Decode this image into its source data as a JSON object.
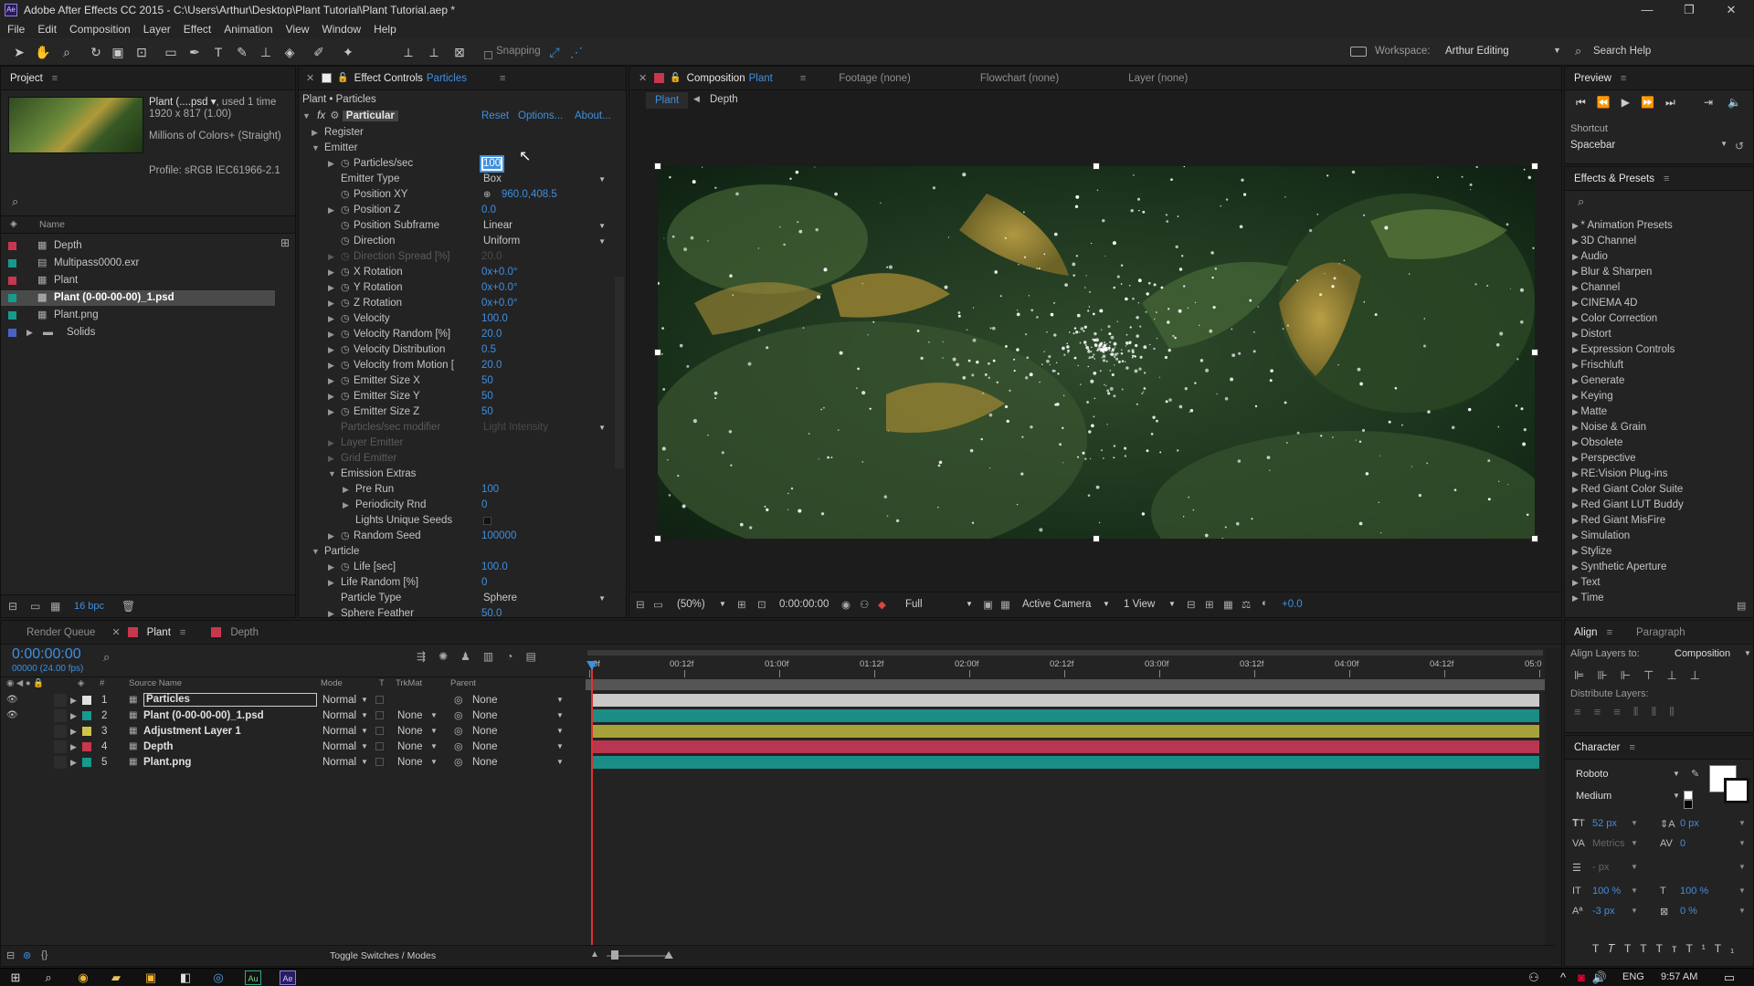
{
  "window": {
    "title": "Adobe After Effects CC 2015 - C:\\Users\\Arthur\\Desktop\\Plant Tutorial\\Plant Tutorial.aep *"
  },
  "menu": [
    "File",
    "Edit",
    "Composition",
    "Layer",
    "Effect",
    "Animation",
    "View",
    "Window",
    "Help"
  ],
  "toolbar": {
    "snapping": "Snapping",
    "workspace_label": "Workspace:",
    "workspace_value": "Arthur Editing",
    "search_help": "Search Help"
  },
  "project": {
    "tab": "Project",
    "asset_name": "Plant (....psd ▾",
    "used": ", used 1 time",
    "dimensions": "1920 x 817 (1.00)",
    "colors": "Millions of Colors+ (Straight)",
    "profile": "Profile: sRGB IEC61966-2.1",
    "col_name": "Name",
    "items": [
      {
        "label": "Depth",
        "color": "#c8374d"
      },
      {
        "label": "Multipass0000.exr",
        "color": "#169a8e"
      },
      {
        "label": "Plant",
        "color": "#c8374d"
      },
      {
        "label": "Plant (0-00-00-00)_1.psd",
        "color": "#169a8e"
      },
      {
        "label": "Plant.png",
        "color": "#169a8e"
      },
      {
        "label": "Solids",
        "color": "#4a62c8"
      }
    ],
    "bpc": "16 bpc"
  },
  "effect_controls": {
    "tab_label": "Effect Controls",
    "tab_layer": "Particles",
    "breadcrumb": "Plant • Particles",
    "effect_name": "Particular",
    "reset": "Reset",
    "options": "Options...",
    "about": "About...",
    "rows": [
      {
        "indent": 1,
        "label": "Register",
        "tri": "▶"
      },
      {
        "indent": 1,
        "label": "Emitter",
        "tri": "▼"
      },
      {
        "indent": 2,
        "label": "Particles/sec",
        "tri": "▶",
        "sw": true,
        "value": "100",
        "editing": true
      },
      {
        "indent": 2,
        "label": "Emitter Type",
        "dropdown": "Box"
      },
      {
        "indent": 2,
        "label": "Position XY",
        "sw": true,
        "value": "960.0,408.5",
        "target": true
      },
      {
        "indent": 2,
        "label": "Position Z",
        "tri": "▶",
        "sw": true,
        "value": "0.0"
      },
      {
        "indent": 2,
        "label": "Position Subframe",
        "sw": true,
        "dropdown": "Linear"
      },
      {
        "indent": 2,
        "label": "Direction",
        "sw": true,
        "dropdown": "Uniform"
      },
      {
        "indent": 2,
        "label": "Direction Spread [%]",
        "tri": "▶",
        "sw": true,
        "value": "20.0",
        "dim": true
      },
      {
        "indent": 2,
        "label": "X Rotation",
        "tri": "▶",
        "sw": true,
        "value": "0x+0.0°"
      },
      {
        "indent": 2,
        "label": "Y Rotation",
        "tri": "▶",
        "sw": true,
        "value": "0x+0.0°"
      },
      {
        "indent": 2,
        "label": "Z Rotation",
        "tri": "▶",
        "sw": true,
        "value": "0x+0.0°"
      },
      {
        "indent": 2,
        "label": "Velocity",
        "tri": "▶",
        "sw": true,
        "value": "100.0"
      },
      {
        "indent": 2,
        "label": "Velocity Random [%]",
        "tri": "▶",
        "sw": true,
        "value": "20.0"
      },
      {
        "indent": 2,
        "label": "Velocity Distribution",
        "tri": "▶",
        "sw": true,
        "value": "0.5"
      },
      {
        "indent": 2,
        "label": "Velocity from Motion [",
        "tri": "▶",
        "sw": true,
        "value": "20.0"
      },
      {
        "indent": 2,
        "label": "Emitter Size X",
        "tri": "▶",
        "sw": true,
        "value": "50"
      },
      {
        "indent": 2,
        "label": "Emitter Size Y",
        "tri": "▶",
        "sw": true,
        "value": "50"
      },
      {
        "indent": 2,
        "label": "Emitter Size Z",
        "tri": "▶",
        "sw": true,
        "value": "50"
      },
      {
        "indent": 2,
        "label": "Particles/sec modifier",
        "dropdown": "Light Intensity",
        "dim": true
      },
      {
        "indent": 2,
        "label": "Layer Emitter",
        "tri": "▶",
        "dim": true
      },
      {
        "indent": 2,
        "label": "Grid Emitter",
        "tri": "▶",
        "dim": true
      },
      {
        "indent": 2,
        "label": "Emission Extras",
        "tri": "▼"
      },
      {
        "indent": 3,
        "label": "Pre Run",
        "tri": "▶",
        "value": "100"
      },
      {
        "indent": 3,
        "label": "Periodicity Rnd",
        "tri": "▶",
        "value": "0"
      },
      {
        "indent": 3,
        "label": "Lights Unique Seeds",
        "check": true
      },
      {
        "indent": 2,
        "label": "Random Seed",
        "tri": "▶",
        "sw": true,
        "value": "100000"
      },
      {
        "indent": 1,
        "label": "Particle",
        "tri": "▼"
      },
      {
        "indent": 2,
        "label": "Life [sec]",
        "tri": "▶",
        "sw": true,
        "value": "100.0"
      },
      {
        "indent": 2,
        "label": "Life Random [%]",
        "tri": "▶",
        "value": "0"
      },
      {
        "indent": 2,
        "label": "Particle Type",
        "dropdown": "Sphere"
      },
      {
        "indent": 2,
        "label": "Sphere Feather",
        "tri": "▶",
        "value": "50.0"
      }
    ]
  },
  "composition": {
    "tab_label": "Composition",
    "tab_comp": "Plant",
    "footage": "Footage (none)",
    "flowchart": "Flowchart (none)",
    "layer": "Layer (none)",
    "sub_tabs": [
      "Plant",
      "Depth"
    ],
    "zoom": "(50%)",
    "timecode": "0:00:00:00",
    "resolution": "Full",
    "camera": "Active Camera",
    "views": "1 View",
    "exposure": "+0.0"
  },
  "preview": {
    "tab": "Preview",
    "shortcut_label": "Shortcut",
    "shortcut_value": "Spacebar"
  },
  "effects_presets": {
    "tab": "Effects & Presets",
    "items": [
      "* Animation Presets",
      "3D Channel",
      "Audio",
      "Blur & Sharpen",
      "Channel",
      "CINEMA 4D",
      "Color Correction",
      "Distort",
      "Expression Controls",
      "Frischluft",
      "Generate",
      "Keying",
      "Matte",
      "Noise & Grain",
      "Obsolete",
      "Perspective",
      "RE:Vision Plug-ins",
      "Red Giant Color Suite",
      "Red Giant LUT Buddy",
      "Red Giant MisFire",
      "Simulation",
      "Stylize",
      "Synthetic Aperture",
      "Text",
      "Time"
    ]
  },
  "timeline": {
    "tabs": [
      "Render Queue",
      "Plant",
      "Depth"
    ],
    "timecode": "0:00:00:00",
    "fps": "00000 (24.00 fps)",
    "cols": {
      "num": "#",
      "source": "Source Name",
      "mode": "Mode",
      "t": "T",
      "trkmat": "TrkMat",
      "parent": "Parent"
    },
    "ruler": [
      "0f",
      "00:12f",
      "01:00f",
      "01:12f",
      "02:00f",
      "02:12f",
      "03:00f",
      "03:12f",
      "04:00f",
      "04:12f",
      "05:0"
    ],
    "layers": [
      {
        "num": "1",
        "name": "Particles",
        "label_color": "#e0e0e0",
        "mode": "Normal",
        "trkmat": "",
        "parent": "None",
        "bar": "#c9c9c9",
        "selected": true
      },
      {
        "num": "2",
        "name": "Plant (0-00-00-00)_1.psd",
        "label_color": "#169a8e",
        "mode": "Normal",
        "trkmat": "None",
        "parent": "None",
        "bar": "#1a8d86"
      },
      {
        "num": "3",
        "name": "Adjustment Layer 1",
        "label_color": "#cfc44a",
        "mode": "Normal",
        "trkmat": "None",
        "parent": "None",
        "bar": "#a6a23a"
      },
      {
        "num": "4",
        "name": "Depth",
        "label_color": "#c8374d",
        "mode": "Normal",
        "trkmat": "None",
        "parent": "None",
        "bar": "#b83650"
      },
      {
        "num": "5",
        "name": "Plant.png",
        "label_color": "#169a8e",
        "mode": "Normal",
        "trkmat": "None",
        "parent": "None",
        "bar": "#1a8d86"
      }
    ],
    "toggle": "Toggle Switches / Modes"
  },
  "align": {
    "tabs": [
      "Align",
      "Paragraph"
    ],
    "align_to_label": "Align Layers to:",
    "align_to_value": "Composition",
    "distribute": "Distribute Layers:"
  },
  "character": {
    "tab": "Character",
    "font": "Roboto",
    "style": "Medium",
    "size": "52 px",
    "leading": "0 px",
    "kerning": "Metrics",
    "tracking": "0",
    "stroke": "- px",
    "vscale": "100 %",
    "hscale": "100 %",
    "baseline": "-3 px",
    "tsume": "0 %",
    "fill_color": "#ffffff",
    "stroke_color": "#000000"
  },
  "taskbar": {
    "lang": "ENG",
    "time": "9:57 AM"
  }
}
